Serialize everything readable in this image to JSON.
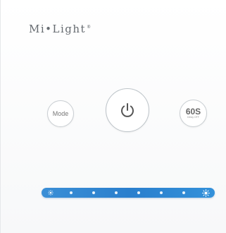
{
  "brand": {
    "name": "Mi•Light",
    "mark": "®"
  },
  "buttons": {
    "mode_label": "Mode",
    "timer_label": "60S",
    "timer_sub": "Delay OFF"
  },
  "icons": {
    "power": "power-icon",
    "sun_dim": "sun-dim-icon",
    "sun_bright": "sun-bright-icon"
  },
  "colors": {
    "slider": "#2a7fcd",
    "brand_text": "#666b70",
    "button_border": "#c9ced2"
  }
}
